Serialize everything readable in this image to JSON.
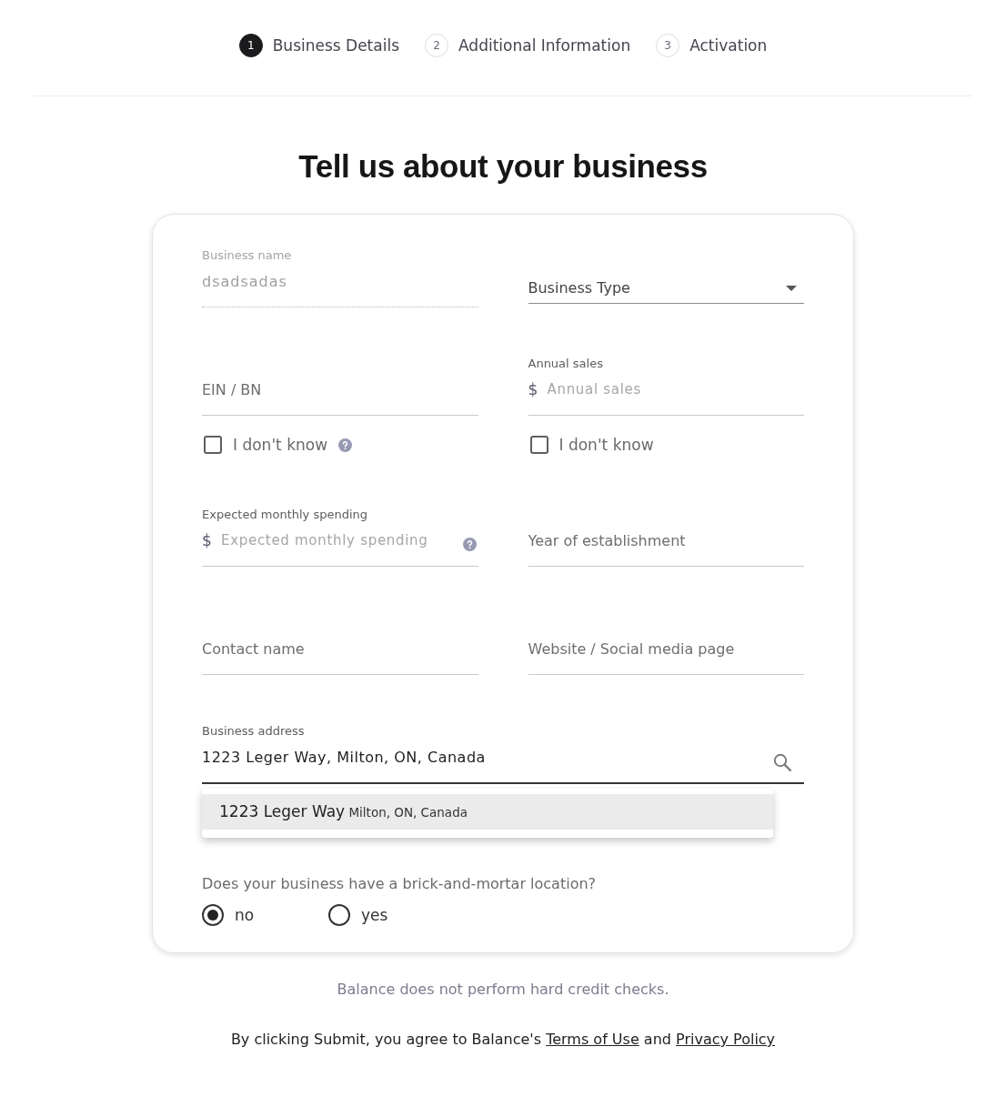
{
  "stepper": [
    {
      "number": "1",
      "label": "Business Details",
      "selected": true
    },
    {
      "number": "2",
      "label": "Additional Information",
      "selected": false
    },
    {
      "number": "3",
      "label": "Activation",
      "selected": false
    }
  ],
  "heading": "Tell us about your business",
  "form": {
    "rows": [
      [
        {
          "kind": "text",
          "label": "Business name",
          "value": "dsadsadas",
          "disabled": true
        },
        {
          "kind": "select",
          "placeholder": "Business Type",
          "disabled": false
        }
      ],
      [
        {
          "kind": "text",
          "placeholder": "EIN / BN",
          "disabled": false,
          "checkbox": {
            "label": "I don't know",
            "checked": false,
            "help": true
          }
        },
        {
          "kind": "money",
          "label": "Annual sales",
          "prefix": "$",
          "placeholder": "Annual sales",
          "disabled": false,
          "checkbox": {
            "label": "I don't know",
            "checked": false
          }
        }
      ],
      [
        {
          "kind": "money",
          "label": "Expected monthly spending",
          "prefix": "$",
          "placeholder": "Expected monthly spending",
          "disabled": false,
          "help": true
        },
        {
          "kind": "text",
          "placeholder": "Year of establishment",
          "disabled": false
        }
      ],
      [
        {
          "kind": "text",
          "placeholder": "Contact name",
          "disabled": false
        },
        {
          "kind": "text",
          "placeholder": "Website / Social media page",
          "disabled": false
        }
      ]
    ],
    "address": {
      "label": "Business address",
      "value": "1223 Leger Way, Milton, ON, Canada",
      "focused": true,
      "suggestions": [
        {
          "primary": "1223 Leger Way",
          "secondary": "Milton, ON, Canada",
          "selected": true
        }
      ]
    },
    "question": {
      "text": "Does your business have a brick-and-mortar location?",
      "options": [
        {
          "label": "no",
          "selected": true
        },
        {
          "label": "yes",
          "selected": false
        }
      ]
    }
  },
  "note": "Balance does not perform hard credit checks.",
  "consent": [
    {
      "kind": "text",
      "text": "By clicking Submit, you agree to Balance's "
    },
    {
      "kind": "link",
      "text": "Terms of Use"
    },
    {
      "kind": "text",
      "text": " and "
    },
    {
      "kind": "link",
      "text": "Privacy Policy"
    }
  ]
}
